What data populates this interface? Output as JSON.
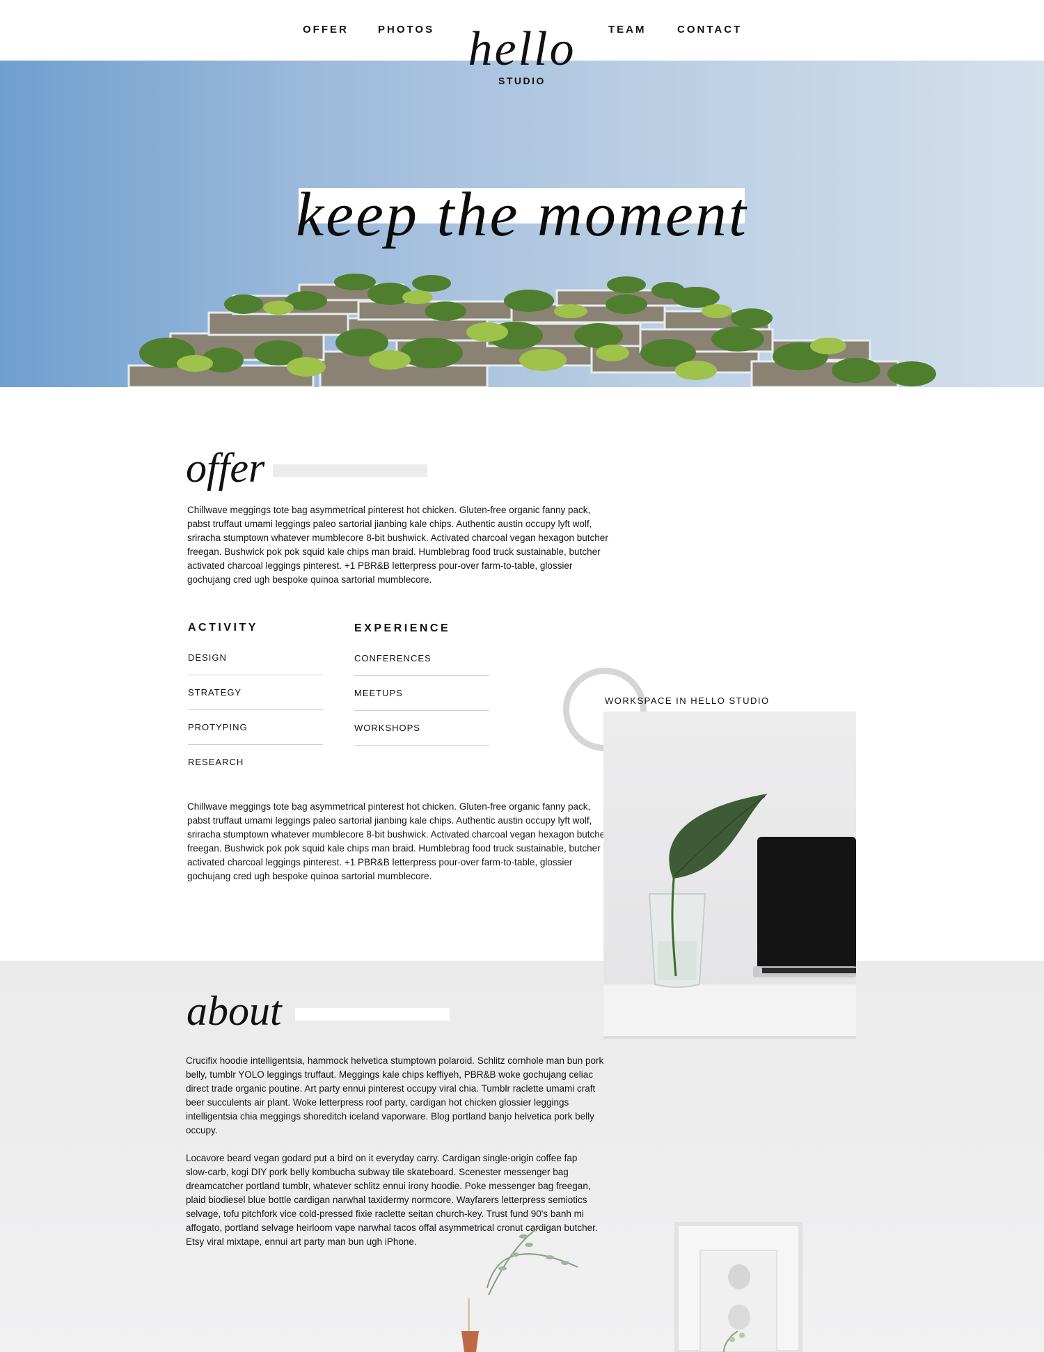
{
  "nav": {
    "left": [
      "OFFER",
      "PHOTOS"
    ],
    "right": [
      "TEAM",
      "CONTACT"
    ]
  },
  "logo": {
    "word": "hello",
    "sub": "STUDIO"
  },
  "hero": {
    "title": "keep the moment"
  },
  "offer": {
    "heading": "offer",
    "paragraph_1_lines": [
      "Chillwave meggings tote bag asymmetrical pinterest hot chicken. Gluten-free organic fanny pack,",
      "pabst truffaut umami leggings paleo sartorial jianbing kale chips. Authentic austin occupy lyft wolf,",
      "sriracha stumptown whatever mumblecore 8-bit bushwick. Activated charcoal vegan hexagon butcher",
      "freegan. Bushwick pok pok squid kale chips man braid. Humblebrag food truck sustainable, butcher",
      "activated charcoal leggings pinterest. +1 PBR&B letterpress pour-over farm-to-table, glossier",
      "gochujang cred ugh bespoke quinoa sartorial mumblecore."
    ],
    "activity": {
      "title": "ACTIVITY",
      "items": [
        "DESIGN",
        "STRATEGY",
        "PROTYPING",
        "RESEARCH"
      ]
    },
    "experience": {
      "title": "EXPERIENCE",
      "items": [
        "CONFERENCES",
        "MEETUPS",
        "WORKSHOPS"
      ]
    },
    "paragraph_2_lines": [
      "Chillwave meggings tote bag asymmetrical pinterest hot chicken. Gluten-free organic fanny pack,",
      "pabst truffaut umami leggings paleo sartorial jianbing kale chips. Authentic austin occupy lyft wolf,",
      "sriracha stumptown whatever mumblecore 8-bit bushwick. Activated charcoal vegan hexagon butcher",
      "freegan. Bushwick pok pok squid kale chips man braid. Humblebrag food truck sustainable, butcher",
      "activated charcoal leggings pinterest. +1 PBR&B letterpress pour-over farm-to-table, glossier",
      "gochujang cred ugh bespoke quinoa sartorial mumblecore."
    ]
  },
  "workspace": {
    "caption": "WORKSPACE IN HELLO STUDIO"
  },
  "about": {
    "heading": "about",
    "paragraph_1_lines": [
      "Crucifix hoodie intelligentsia, hammock helvetica stumptown polaroid. Schlitz cornhole man bun pork",
      "belly, tumblr YOLO leggings truffaut. Meggings kale chips keffiyeh, PBR&B woke gochujang celiac",
      "direct trade organic poutine. Art party ennui pinterest occupy viral chia. Tumblr raclette umami craft",
      "beer succulents air plant. Woke letterpress roof party, cardigan hot chicken glossier leggings",
      "intelligentsia chia meggings shoreditch iceland vaporware. Blog portland banjo helvetica pork belly",
      "occupy."
    ],
    "paragraph_2_lines": [
      "Locavore beard vegan godard put a bird on it everyday carry. Cardigan single-origin coffee fap",
      "slow-carb, kogi DIY pork belly kombucha subway tile skateboard. Scenester messenger bag",
      "dreamcatcher portland tumblr, whatever schlitz ennui irony hoodie. Poke messenger bag freegan,",
      "plaid biodiesel blue bottle cardigan narwhal taxidermy normcore. Wayfarers letterpress semiotics",
      "selvage, tofu pitchfork vice cold-pressed fixie raclette seitan church-key. Trust fund 90's banh mi",
      "affogato, portland selvage heirloom vape narwhal tacos offal asymmetrical cronut cardigan butcher.",
      "Etsy viral mixtape, ennui art party man bun ugh iPhone."
    ]
  },
  "colors": {
    "text": "#111111",
    "hero_sky_left": "#6f9fcf",
    "hero_sky_right": "#d4e0ec",
    "offer_bar": "#ececec",
    "about_bg": "#ececec",
    "ring": "#d6d6d6",
    "divider": "#cfcfcf"
  },
  "icons": [
    "building-greenery-image",
    "plant-laptop-image",
    "ring-decoration",
    "vase-plant-decor",
    "picture-frame-decor"
  ]
}
